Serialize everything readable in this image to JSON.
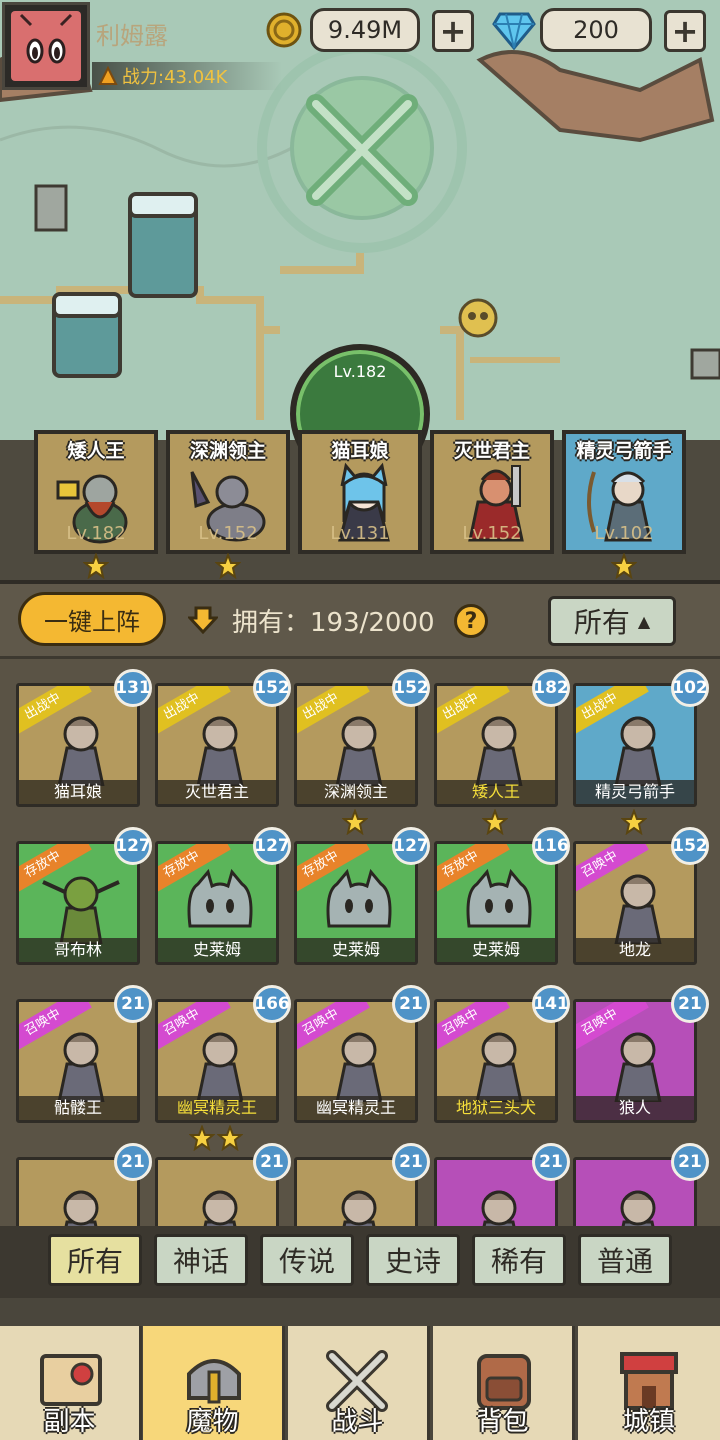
{
  "player": {
    "name": "利姆露",
    "power": "战力:43.04K",
    "gold": "9.49M",
    "gems": "200"
  },
  "squad": {
    "leader_level": "Lv.182",
    "members": [
      {
        "name": "矮人王",
        "level": "Lv.182",
        "stars": 1
      },
      {
        "name": "深渊领主",
        "level": "Lv.152",
        "stars": 1
      },
      {
        "name": "猫耳娘",
        "level": "Lv.131",
        "stars": 0
      },
      {
        "name": "灭世君主",
        "level": "Lv.152",
        "stars": 0
      },
      {
        "name": "精灵弓箭手",
        "level": "Lv.102",
        "stars": 1
      }
    ]
  },
  "toolbar": {
    "deploy_label": "一键上阵",
    "owned_text": "拥有：193/2000",
    "help": "?",
    "filter_label": "所有"
  },
  "monsters": [
    {
      "name": "猫耳娘",
      "level": "131",
      "tag": "出战中",
      "stars": 0,
      "gold": false
    },
    {
      "name": "灭世君主",
      "level": "152",
      "tag": "出战中",
      "stars": 0,
      "gold": false
    },
    {
      "name": "深渊领主",
      "level": "152",
      "tag": "出战中",
      "stars": 1,
      "gold": false
    },
    {
      "name": "矮人王",
      "level": "182",
      "tag": "出战中",
      "stars": 1,
      "gold": true
    },
    {
      "name": "精灵弓箭手",
      "level": "102",
      "tag": "出战中",
      "stars": 1,
      "gold": false
    },
    {
      "name": "哥布林",
      "level": "127",
      "tag": "存放中",
      "stars": 0,
      "gold": false
    },
    {
      "name": "史莱姆",
      "level": "127",
      "tag": "存放中",
      "stars": 0,
      "gold": false
    },
    {
      "name": "史莱姆",
      "level": "127",
      "tag": "存放中",
      "stars": 0,
      "gold": false
    },
    {
      "name": "史莱姆",
      "level": "116",
      "tag": "存放中",
      "stars": 0,
      "gold": false
    },
    {
      "name": "地龙",
      "level": "152",
      "tag": "召唤中",
      "stars": 0,
      "gold": false
    },
    {
      "name": "骷髅王",
      "level": "21",
      "tag": "召唤中",
      "stars": 0,
      "gold": false
    },
    {
      "name": "幽冥精灵王",
      "level": "166",
      "tag": "召唤中",
      "stars": 2,
      "gold": true
    },
    {
      "name": "幽冥精灵王",
      "level": "21",
      "tag": "召唤中",
      "stars": 0,
      "gold": false
    },
    {
      "name": "地狱三头犬",
      "level": "141",
      "tag": "召唤中",
      "stars": 0,
      "gold": true
    },
    {
      "name": "狼人",
      "level": "21",
      "tag": "召唤中",
      "stars": 0,
      "gold": false
    },
    {
      "name": "",
      "level": "21",
      "tag": "",
      "stars": 0,
      "gold": false
    },
    {
      "name": "",
      "level": "21",
      "tag": "",
      "stars": 0,
      "gold": false
    },
    {
      "name": "",
      "level": "21",
      "tag": "",
      "stars": 0,
      "gold": false
    },
    {
      "name": "",
      "level": "21",
      "tag": "",
      "stars": 0,
      "gold": false
    },
    {
      "name": "",
      "level": "21",
      "tag": "",
      "stars": 0,
      "gold": false
    }
  ],
  "rarity_tabs": [
    "所有",
    "神话",
    "传说",
    "史诗",
    "稀有",
    "普通"
  ],
  "nav": [
    {
      "label": "副本",
      "icon": "map-scroll-icon"
    },
    {
      "label": "魔物",
      "icon": "helmet-icon"
    },
    {
      "label": "战斗",
      "icon": "crossed-swords-icon"
    },
    {
      "label": "背包",
      "icon": "backpack-icon"
    },
    {
      "label": "城镇",
      "icon": "shop-icon"
    }
  ],
  "colors": {
    "deployed_tag": "#e0c020",
    "stored_tag": "#e8832a",
    "summon_tag": "#d44ad0",
    "card_gold": "#b49a5e",
    "card_green": "#5bb55a",
    "card_purple": "#b64fb8",
    "level_bubble": "#4f93c7",
    "accent": "#f4b832"
  }
}
